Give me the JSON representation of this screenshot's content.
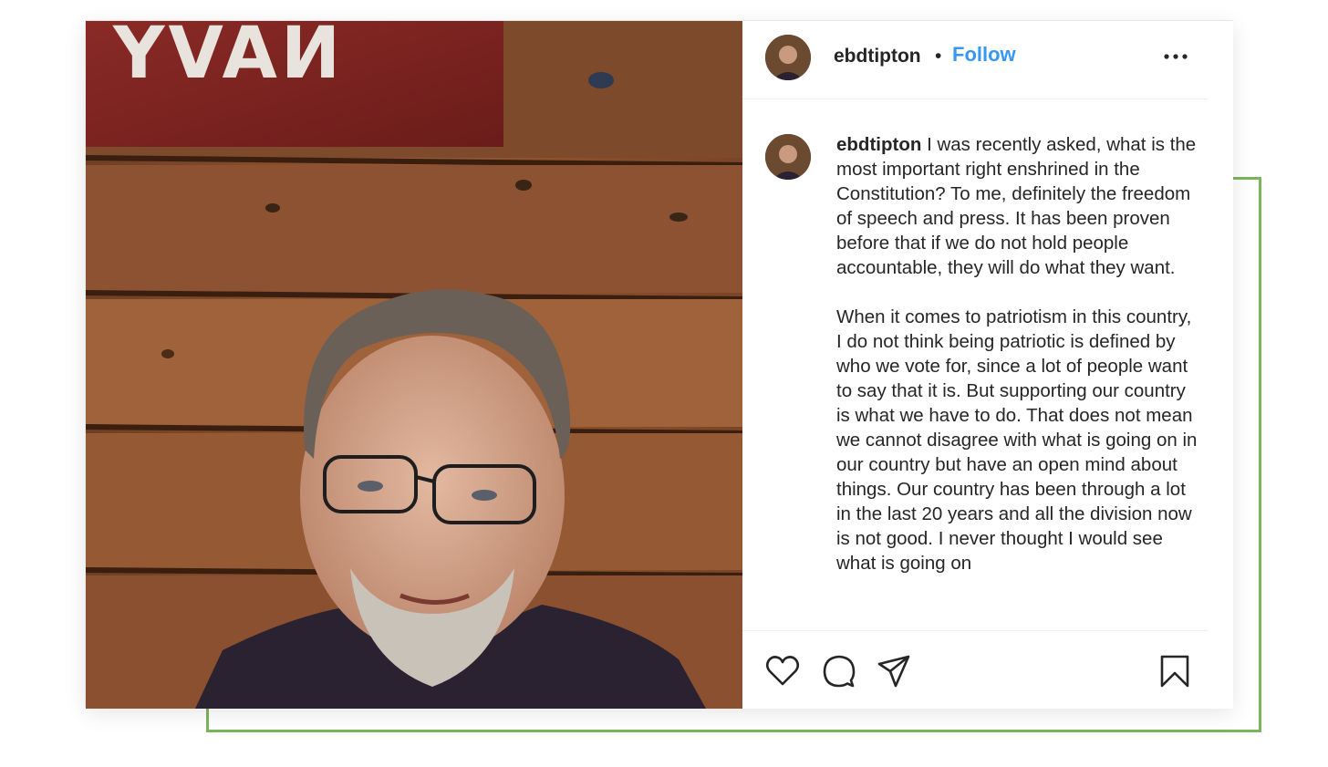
{
  "post": {
    "username": "ebdtipton",
    "separator": "•",
    "follow_label": "Follow",
    "more_icon": "more-options-icon"
  },
  "photo": {
    "sign_text": "NAVY"
  },
  "caption": {
    "author": "ebdtipton",
    "paragraph_1": "I was recently asked, what is the most important right enshrined in the Constitution? To me, definitely the freedom of speech and press. It has been proven before that if we do not hold people accountable, they will do what they want.",
    "paragraph_2": "When it comes to patriotism in this country,  I do not think being patriotic is defined by who we vote for, since a lot of people want to say that it is. But supporting our country is what we have to do. That does not mean we cannot disagree with what is going on in our country but have an open mind about things. Our country has been through a lot in the last 20 years and all the division now is not good. I never thought I would see what is going on"
  },
  "actions": {
    "icons": [
      "heart-icon",
      "comment-icon",
      "share-icon",
      "bookmark-icon"
    ]
  },
  "colors": {
    "follow_blue": "#3897f0",
    "frame_green": "#7ab55c",
    "text": "#262626"
  }
}
